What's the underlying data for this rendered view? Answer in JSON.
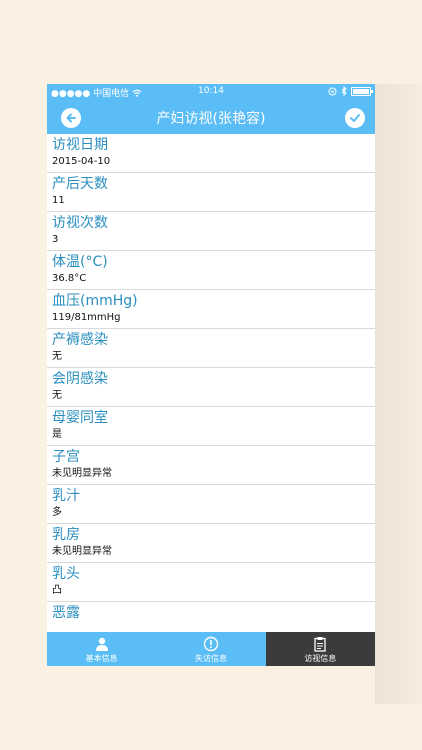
{
  "status": {
    "carrier": "●●●●● 中国电信",
    "time": "10:14"
  },
  "nav": {
    "title": "产妇访视(张艳容)"
  },
  "rows": [
    {
      "label": "访视日期",
      "value": "2015-04-10"
    },
    {
      "label": "产后天数",
      "value": "11"
    },
    {
      "label": "访视次数",
      "value": "3"
    },
    {
      "label": "体温(°C)",
      "value": "36.8°C"
    },
    {
      "label": "血压(mmHg)",
      "value": "119/81mmHg"
    },
    {
      "label": "产褥感染",
      "value": "无"
    },
    {
      "label": "会阴感染",
      "value": "无"
    },
    {
      "label": "母婴同室",
      "value": "是"
    },
    {
      "label": "子宫",
      "value": "未见明显异常"
    },
    {
      "label": "乳汁",
      "value": "多"
    },
    {
      "label": "乳房",
      "value": "未见明显异常"
    },
    {
      "label": "乳头",
      "value": "凸"
    },
    {
      "label": "恶露",
      "value": ""
    }
  ],
  "tabs": [
    {
      "label": "基本信息",
      "icon": "person-icon"
    },
    {
      "label": "失访信息",
      "icon": "alert-icon"
    },
    {
      "label": "访视信息",
      "icon": "clipboard-icon"
    }
  ],
  "colors": {
    "accent": "#5bbdf5",
    "label": "#2a8fbf",
    "active_tab": "#3b3b3b"
  }
}
